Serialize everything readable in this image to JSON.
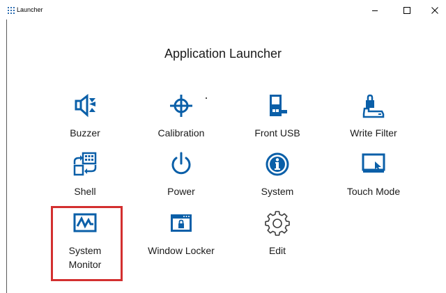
{
  "window": {
    "title": "Launcher",
    "controls": {
      "minimize": "–",
      "maximize": "□",
      "close": "✕"
    }
  },
  "heading": "Application Launcher",
  "accent_color": "#0a5fa8",
  "highlight_color": "#d32f2f",
  "tiles": [
    {
      "label": "Buzzer",
      "icon": "speaker-icon"
    },
    {
      "label": "Calibration",
      "icon": "crosshair-icon"
    },
    {
      "label": "Front USB",
      "icon": "usb-icon"
    },
    {
      "label": "Write Filter",
      "icon": "drive-lock-icon"
    },
    {
      "label": "Shell",
      "icon": "shell-swap-icon"
    },
    {
      "label": "Power",
      "icon": "power-icon"
    },
    {
      "label": "System",
      "icon": "info-icon"
    },
    {
      "label": "Touch Mode",
      "icon": "touch-screen-icon"
    },
    {
      "label": "System\nMonitor",
      "icon": "monitor-graph-icon"
    },
    {
      "label": "Window Locker",
      "icon": "window-lock-icon"
    },
    {
      "label": "Edit",
      "icon": "gear-icon"
    }
  ]
}
